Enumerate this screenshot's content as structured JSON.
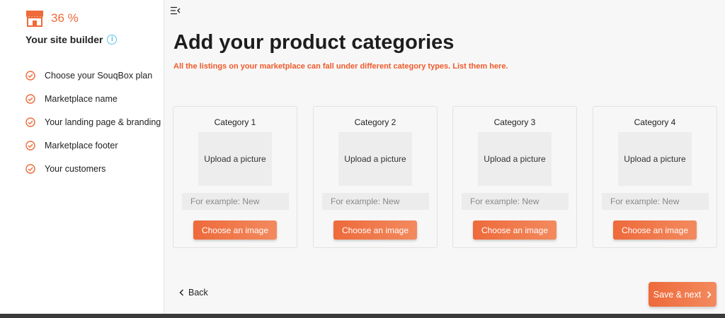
{
  "sidebar": {
    "progress_percent": "36 %",
    "progress_value": 36,
    "progress_icon": "store-icon",
    "builder_title": "Your site builder",
    "info_icon_glyph": "i",
    "steps": [
      {
        "label": "Choose your SouqBox plan",
        "done": true
      },
      {
        "label": "Marketplace name",
        "done": true
      },
      {
        "label": "Your landing page & branding",
        "done": true
      },
      {
        "label": "Marketplace footer",
        "done": true
      },
      {
        "label": "Your customers",
        "done": true
      }
    ]
  },
  "header": {
    "menu_icon": "collapse-menu-icon",
    "title": "Add your product categories",
    "subtitle": "All the listings on your marketplace can fall under different category types. List them here."
  },
  "categories": [
    {
      "title": "Category 1",
      "upload_label": "Upload a picture",
      "placeholder": "For example: New",
      "value": "",
      "button_label": "Choose an image"
    },
    {
      "title": "Category 2",
      "upload_label": "Upload a picture",
      "placeholder": "For example: New",
      "value": "",
      "button_label": "Choose an image"
    },
    {
      "title": "Category 3",
      "upload_label": "Upload a picture",
      "placeholder": "For example: New",
      "value": "",
      "button_label": "Choose an image"
    },
    {
      "title": "Category 4",
      "upload_label": "Upload a picture",
      "placeholder": "For example: New",
      "value": "",
      "button_label": "Choose an image"
    }
  ],
  "footer": {
    "back_label": "Back",
    "next_label": "Save & next"
  },
  "colors": {
    "accent": "#ef6a3a",
    "subtitle": "#ef5a2a",
    "info": "#5bc3e8"
  }
}
